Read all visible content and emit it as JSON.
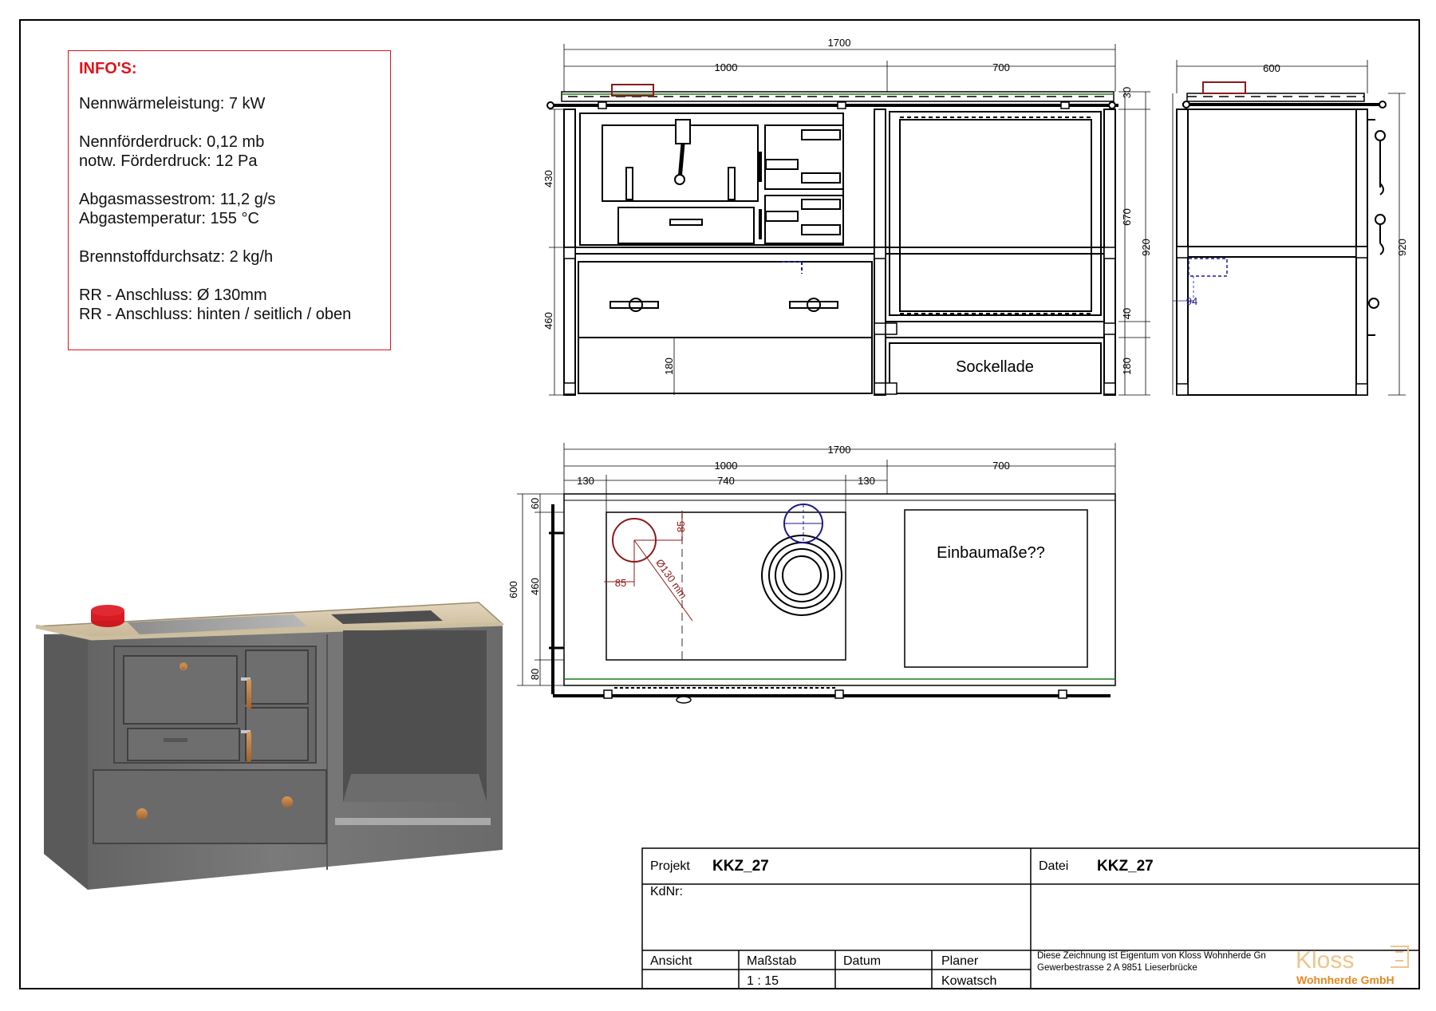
{
  "info": {
    "title": "INFO'S:",
    "nennwaerme": "Nennwärmeleistung: 7 kW",
    "nennfoerder": "Nennförderdruck: 0,12 mb",
    "notw": "notw. Förderdruck: 12 Pa",
    "abgasmasse": "Abgasmassestrom: 11,2 g/s",
    "abgastemp": "Abgastemperatur: 155 °C",
    "brennstoff": "Brennstoffdurchsatz: 2 kg/h",
    "rr1": "RR - Anschluss: Ø 130mm",
    "rr2": "RR - Anschluss: hinten / seitlich / oben"
  },
  "front": {
    "dim_total": "1700",
    "dim_left": "1000",
    "dim_right": "700",
    "dim_430": "430",
    "dim_460": "460",
    "dim_180_inner": "180",
    "dim_30": "30",
    "dim_670": "670",
    "dim_920": "920",
    "dim_40": "40",
    "dim_180": "180",
    "sockel_label": "Sockellade"
  },
  "side": {
    "dim_600": "600",
    "dim_920": "920",
    "dim_94": "94"
  },
  "top": {
    "dim_total": "1700",
    "dim_left": "1000",
    "dim_right": "700",
    "dim_130a": "130",
    "dim_740": "740",
    "dim_130b": "130",
    "dim_600": "600",
    "dim_460": "460",
    "dim_60": "60",
    "dim_80": "80",
    "dim_85a": "85",
    "dim_85b": "85",
    "dim_dia": "Ø130 mm",
    "einbau_label": "Einbaumaße??"
  },
  "titleblock": {
    "projekt_label": "Projekt",
    "projekt_value": "KKZ_27",
    "datei_label": "Datei",
    "datei_value": "KKZ_27",
    "kdnr_label": "KdNr:",
    "ansicht_label": "Ansicht",
    "massstab_label": "Maßstab",
    "massstab_value": "1 : 15",
    "datum_label": "Datum",
    "planer_label": "Planer",
    "planer_value": "Kowatsch",
    "owner_line1": "Diese Zeichnung ist Eigentum von Kloss Wohnherde Gn",
    "owner_line2": "Gewerbestrasse 2 A 9851 Lieserbrücke",
    "logo_word": "Kloss",
    "logo_sub": "Wohnherde GmbH"
  },
  "colors": {
    "accent_red": "#e0141c",
    "dim_red": "#8b1a1a",
    "dim_blue": "#1a1a8b",
    "logo_orange": "#e8a24a",
    "stove_grey": "#707070"
  }
}
